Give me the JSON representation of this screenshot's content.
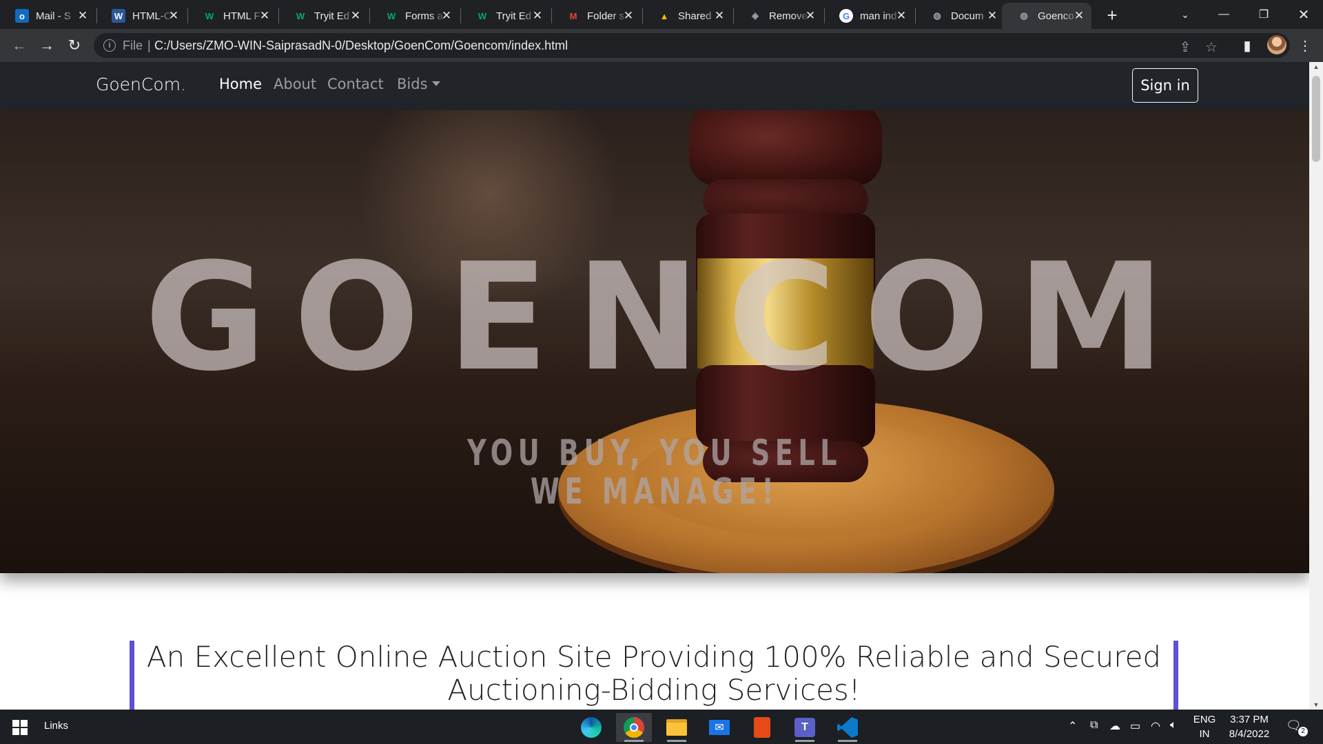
{
  "browser": {
    "tabs": [
      {
        "title": "Mail - S",
        "icon": "outlook-icon",
        "color": "#0f6cbd"
      },
      {
        "title": "HTML-C",
        "icon": "word-icon",
        "color": "#2b579a"
      },
      {
        "title": "HTML F",
        "icon": "w3schools-icon",
        "color": "#04aa6d"
      },
      {
        "title": "Tryit Ed",
        "icon": "w3schools-icon",
        "color": "#04aa6d"
      },
      {
        "title": "Forms a",
        "icon": "w3schools-icon",
        "color": "#04aa6d"
      },
      {
        "title": "Tryit Ed",
        "icon": "w3schools-icon",
        "color": "#04aa6d"
      },
      {
        "title": "Folder s",
        "icon": "gmail-icon",
        "color": "#ea4335"
      },
      {
        "title": "Shared",
        "icon": "google-drive-icon",
        "color": "#fbbc04"
      },
      {
        "title": "Remove",
        "icon": "layers-icon",
        "color": "#9aa0a6"
      },
      {
        "title": "man ind",
        "icon": "google-icon",
        "color": "#4285f4"
      },
      {
        "title": "Docum",
        "icon": "globe-icon",
        "color": "#9aa0a6"
      },
      {
        "title": "Goenco",
        "icon": "globe-icon",
        "color": "#9aa0a6",
        "active": true
      }
    ],
    "address": {
      "scheme_label": "File",
      "separator": "|",
      "url": "C:/Users/ZMO-WIN-SaiprasadN-0/Desktop/GoenCom/Goencom/index.html"
    }
  },
  "site": {
    "brand": "GoenCom.",
    "nav": {
      "home": "Home",
      "about": "About",
      "contact": "Contact",
      "bids": "Bids"
    },
    "signin": "Sign in",
    "hero": {
      "title": "GOENCOM",
      "tagline_line1": "YOU BUY, YOU SELL",
      "tagline_line2": "WE MANAGE!"
    },
    "intro": "An Excellent Online Auction Site Providing 100% Reliable and Secured Auctioning-Bidding Services!",
    "accent_color": "#5b52d6"
  },
  "taskbar": {
    "links_label": "Links",
    "language_line1": "ENG",
    "language_line2": "IN",
    "time": "3:37 PM",
    "date": "8/4/2022",
    "notification_count": "2"
  }
}
